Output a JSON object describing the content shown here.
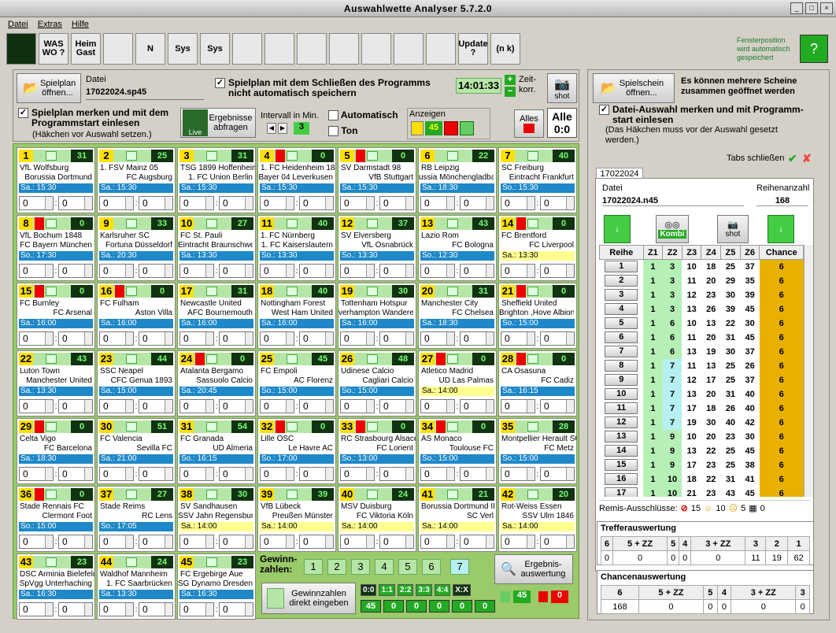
{
  "window": {
    "title": "Auswahlwette Analyser 5.7.2.0"
  },
  "menu": [
    "Datei",
    "Extras",
    "Hilfe"
  ],
  "toolbar": [
    "",
    "WAS WO ?",
    "Heim Gast",
    "",
    "N",
    "Sys",
    "Sys",
    "",
    "",
    "",
    "",
    "",
    "",
    "",
    "Update ?",
    "(n k)"
  ],
  "fenster_note": "Fensterposition wird automatisch gespeichert",
  "spielplan": {
    "open_label": "Spielplan öffnen...",
    "file_label": "Datei",
    "file_value": "17022024.sp45",
    "nosave_label": "Spielplan mit dem Schließen des Programms nicht automatisch speichern",
    "time": "14:01:33",
    "zeit_label": "Zeit-korr.",
    "shot": "shot",
    "remember_label": "Spielplan merken und mit dem Programmstart einlesen",
    "remember_hint": "(Häkchen vor Auswahl setzen.)",
    "results_btn": "Ergebnisse abfragen",
    "live": "Live",
    "interval_label": "Intervall in Min.",
    "interval_value": "3",
    "auto_label": "Automatisch",
    "ton_label": "Ton",
    "anzeigen_label": "Anzeigen",
    "anzeigen_count": "45",
    "alles_label": "Alles",
    "alles_score": "Alle 0:0"
  },
  "matches": [
    {
      "n": "1",
      "home": "VfL Wolfsburg",
      "away": "Borussia Dortmund",
      "date": "Sa.: 15:30",
      "cnt": "31",
      "red": false,
      "dy": false
    },
    {
      "n": "2",
      "home": "1. FSV Mainz 05",
      "away": "FC Augsburg",
      "date": "Sa.: 15:30",
      "cnt": "25",
      "red": false,
      "dy": false
    },
    {
      "n": "3",
      "home": "TSG 1899 Hoffenheim",
      "away": "1. FC Union Berlin",
      "date": "Sa.: 15:30",
      "cnt": "31",
      "red": false,
      "dy": false
    },
    {
      "n": "4",
      "home": "1. FC Heidenheim 1846",
      "away": "Bayer 04 Leverkusen",
      "date": "Sa.: 15:30",
      "cnt": "0",
      "red": true,
      "dy": false
    },
    {
      "n": "5",
      "home": "SV Darmstadt 98",
      "away": "VfB Stuttgart",
      "date": "Sa.: 15:30",
      "cnt": "0",
      "red": true,
      "dy": false
    },
    {
      "n": "6",
      "home": "RB Leipzig",
      "away": "ussia Mönchengladbach",
      "date": "Sa.: 18:30",
      "cnt": "22",
      "red": false,
      "dy": false
    },
    {
      "n": "7",
      "home": "SC Freiburg",
      "away": "Eintracht Frankfurt",
      "date": "So.: 15:30",
      "cnt": "40",
      "red": false,
      "dy": false
    },
    {
      "n": "8",
      "home": "VfL Bochum 1848",
      "away": "FC Bayern München",
      "date": "So.: 17:30",
      "cnt": "0",
      "red": true,
      "dy": false
    },
    {
      "n": "9",
      "home": "Karlsruher SC",
      "away": "Fortuna Düsseldorf",
      "date": "Sa.: 20:30",
      "cnt": "33",
      "red": false,
      "dy": false
    },
    {
      "n": "10",
      "home": "FC St. Pauli",
      "away": "Eintracht Braunschweig",
      "date": "Sa.: 13:30",
      "cnt": "27",
      "red": false,
      "dy": false
    },
    {
      "n": "11",
      "home": "1. FC Nürnberg",
      "away": "1. FC Kaiserslautern",
      "date": "So.: 13:30",
      "cnt": "40",
      "red": false,
      "dy": false
    },
    {
      "n": "12",
      "home": "SV Elversberg",
      "away": "VfL Osnabrück",
      "date": "So.: 13:30",
      "cnt": "37",
      "red": false,
      "dy": false
    },
    {
      "n": "13",
      "home": "Lazio Rom",
      "away": "FC Bologna",
      "date": "So.: 12:30",
      "cnt": "43",
      "red": false,
      "dy": false
    },
    {
      "n": "14",
      "home": "FC Brentford",
      "away": "FC Liverpool",
      "date": "Sa.: 13:30",
      "cnt": "0",
      "red": true,
      "dy": true
    },
    {
      "n": "15",
      "home": "FC Burnley",
      "away": "FC Arsenal",
      "date": "Sa.: 16:00",
      "cnt": "0",
      "red": true,
      "dy": false
    },
    {
      "n": "16",
      "home": "FC Fulham",
      "away": "Aston Villa",
      "date": "Sa.: 16:00",
      "cnt": "0",
      "red": true,
      "dy": false
    },
    {
      "n": "17",
      "home": "Newcastle United",
      "away": "AFC Bournemouth",
      "date": "Sa.: 16:00",
      "cnt": "31",
      "red": false,
      "dy": false
    },
    {
      "n": "18",
      "home": "Nottingham Forest",
      "away": "West Ham United",
      "date": "Sa.: 16:00",
      "cnt": "40",
      "red": false,
      "dy": false
    },
    {
      "n": "19",
      "home": "Tottenham Hotspur",
      "away": "verhampton Wanderers",
      "date": "Sa.: 16:00",
      "cnt": "30",
      "red": false,
      "dy": false
    },
    {
      "n": "20",
      "home": "Manchester City",
      "away": "FC Chelsea",
      "date": "Sa.: 18:30",
      "cnt": "31",
      "red": false,
      "dy": false
    },
    {
      "n": "21",
      "home": "Sheffield United",
      "away": "Brighton ,Hove Albion",
      "date": "So.: 15:00",
      "cnt": "0",
      "red": true,
      "dy": false
    },
    {
      "n": "22",
      "home": "Luton Town",
      "away": "Manchester United",
      "date": "Sa.: 13:30",
      "cnt": "43",
      "red": false,
      "dy": false
    },
    {
      "n": "23",
      "home": "SSC Neapel",
      "away": "CFC Genua 1893",
      "date": "Sa.: 15:00",
      "cnt": "44",
      "red": false,
      "dy": false
    },
    {
      "n": "24",
      "home": "Atalanta Bergamo",
      "away": "Sassuolo Calcio",
      "date": "Sa.: 20:45",
      "cnt": "0",
      "red": true,
      "dy": false
    },
    {
      "n": "25",
      "home": "FC Empoli",
      "away": "AC Florenz",
      "date": "So.: 15:00",
      "cnt": "45",
      "red": false,
      "dy": false
    },
    {
      "n": "26",
      "home": "Udinese Calcio",
      "away": "Cagliari Calcio",
      "date": "So.: 15:00",
      "cnt": "48",
      "red": false,
      "dy": false
    },
    {
      "n": "27",
      "home": "Atletico Madrid",
      "away": "UD Las Palmas",
      "date": "Sa.: 14:00",
      "cnt": "0",
      "red": true,
      "dy": true
    },
    {
      "n": "28",
      "home": "CA Osasuna",
      "away": "FC Cadiz",
      "date": "Sa.: 16:15",
      "cnt": "0",
      "red": true,
      "dy": false
    },
    {
      "n": "29",
      "home": "Celta Vigo",
      "away": "FC Barcelona",
      "date": "Sa.: 18:30",
      "cnt": "0",
      "red": true,
      "dy": false
    },
    {
      "n": "30",
      "home": "FC Valencia",
      "away": "Sevilla FC",
      "date": "Sa.: 21:00",
      "cnt": "51",
      "red": false,
      "dy": false
    },
    {
      "n": "31",
      "home": "FC Granada",
      "away": "UD Almeria",
      "date": "So.: 16:15",
      "cnt": "54",
      "red": false,
      "dy": false
    },
    {
      "n": "32",
      "home": "Lille OSC",
      "away": "Le Havre AC",
      "date": "So.: 17:00",
      "cnt": "0",
      "red": true,
      "dy": false
    },
    {
      "n": "33",
      "home": "RC Strasbourg Alsace",
      "away": "FC Lorient",
      "date": "So.: 13:00",
      "cnt": "0",
      "red": true,
      "dy": false
    },
    {
      "n": "34",
      "home": "AS Monaco",
      "away": "Toulouse FC",
      "date": "So.: 15:00",
      "cnt": "0",
      "red": true,
      "dy": false
    },
    {
      "n": "35",
      "home": "Montpellier Herault SC",
      "away": "FC Metz",
      "date": "So.: 15:00",
      "cnt": "28",
      "red": false,
      "dy": false
    },
    {
      "n": "36",
      "home": "Stade Rennais FC",
      "away": "Clermont Foot",
      "date": "So.: 15:00",
      "cnt": "0",
      "red": true,
      "dy": false
    },
    {
      "n": "37",
      "home": "Stade Reims",
      "away": "RC Lens",
      "date": "So.: 17:05",
      "cnt": "27",
      "red": false,
      "dy": false
    },
    {
      "n": "38",
      "home": "SV Sandhausen",
      "away": "SSV Jahn Regensburg",
      "date": "Sa.: 14:00",
      "cnt": "30",
      "red": false,
      "dy": true
    },
    {
      "n": "39",
      "home": "VfB Lübeck",
      "away": "Preußen Münster",
      "date": "Sa.: 14:00",
      "cnt": "39",
      "red": false,
      "dy": true
    },
    {
      "n": "40",
      "home": "MSV Duisburg",
      "away": "FC Viktoria Köln",
      "date": "Sa.: 14:00",
      "cnt": "24",
      "red": false,
      "dy": true
    },
    {
      "n": "41",
      "home": "Borussia Dortmund II",
      "away": "SC Verl",
      "date": "Sa.: 14:00",
      "cnt": "21",
      "red": false,
      "dy": true
    },
    {
      "n": "42",
      "home": "Rot-Weiss Essen",
      "away": "SSV Ulm 1846",
      "date": "Sa.: 14:00",
      "cnt": "20",
      "red": false,
      "dy": true
    },
    {
      "n": "43",
      "home": "DSC Arminia Bielefeld",
      "away": "SpVgg Unterhaching",
      "date": "Sa.: 16:30",
      "cnt": "23",
      "red": false,
      "dy": false
    },
    {
      "n": "44",
      "home": "Waldhof Mannheim",
      "away": "1. FC Saarbrücken",
      "date": "Sa.: 13:30",
      "cnt": "24",
      "red": false,
      "dy": false
    },
    {
      "n": "45",
      "home": "FC Ergebirge Aue",
      "away": "SG Dynamo Dresden",
      "date": "Sa.: 16:30",
      "cnt": "23",
      "red": false,
      "dy": false
    }
  ],
  "score": "0",
  "gewinn": {
    "label": "Gewinn-zahlen:",
    "numbers": [
      "1",
      "2",
      "3",
      "4",
      "5",
      "6",
      "7"
    ],
    "direct_label": "Gewinnzahlen direkt eingeben",
    "eval_label": "Ergebnis-auswertung",
    "score_labels": [
      "0:0",
      "1:1",
      "2:2",
      "3:3",
      "4:4",
      "X:X"
    ],
    "score_counts": [
      "45",
      "0",
      "0",
      "0",
      "0",
      "0"
    ],
    "lock_green": "45",
    "lock_red": "0"
  },
  "right": {
    "open_label": "Spielschein öffnen...",
    "together_label": "Es können mehrere Scheine zusammen geöffnet werden",
    "remember_label": "Datei-Auswahl merken und mit Programm-start einlesen",
    "remember_hint": "(Das Häkchen muss vor der Auswahl gesetzt werden.)",
    "tabs_close": "Tabs schließen",
    "tab": "17022024",
    "file_label": "Datei",
    "file_value": "17022024.n45",
    "rows_label": "Reihenanzahl",
    "rows_value": "168",
    "kombi": "Kombi",
    "shot": "shot"
  },
  "chance_table": {
    "headers": [
      "Reihe",
      "Z1",
      "Z2",
      "Z3",
      "Z4",
      "Z5",
      "Z6",
      "Chance"
    ],
    "rows": [
      [
        "1",
        "1",
        "3",
        "10",
        "18",
        "25",
        "37",
        "6"
      ],
      [
        "2",
        "1",
        "3",
        "11",
        "20",
        "29",
        "35",
        "6"
      ],
      [
        "3",
        "1",
        "3",
        "12",
        "23",
        "30",
        "39",
        "6"
      ],
      [
        "4",
        "1",
        "3",
        "13",
        "26",
        "39",
        "45",
        "6"
      ],
      [
        "5",
        "1",
        "6",
        "10",
        "13",
        "22",
        "30",
        "6"
      ],
      [
        "6",
        "1",
        "6",
        "11",
        "20",
        "31",
        "45",
        "6"
      ],
      [
        "7",
        "1",
        "6",
        "13",
        "19",
        "30",
        "37",
        "6"
      ],
      [
        "8",
        "1",
        "7",
        "11",
        "13",
        "25",
        "26",
        "6"
      ],
      [
        "9",
        "1",
        "7",
        "12",
        "17",
        "25",
        "37",
        "6"
      ],
      [
        "10",
        "1",
        "7",
        "13",
        "20",
        "31",
        "40",
        "6"
      ],
      [
        "11",
        "1",
        "7",
        "17",
        "18",
        "26",
        "40",
        "6"
      ],
      [
        "12",
        "1",
        "7",
        "19",
        "30",
        "40",
        "42",
        "6"
      ],
      [
        "13",
        "1",
        "9",
        "10",
        "20",
        "23",
        "30",
        "6"
      ],
      [
        "14",
        "1",
        "9",
        "13",
        "22",
        "25",
        "45",
        "6"
      ],
      [
        "15",
        "1",
        "9",
        "17",
        "23",
        "25",
        "38",
        "6"
      ],
      [
        "16",
        "1",
        "10",
        "18",
        "22",
        "31",
        "41",
        "6"
      ],
      [
        "17",
        "1",
        "10",
        "21",
        "23",
        "43",
        "45",
        "6"
      ]
    ]
  },
  "remis": {
    "label": "Remis-Ausschlüsse:",
    "a": "15",
    "b": "10",
    "c": "5",
    "d": "0"
  },
  "treffer": {
    "title": "Trefferauswertung",
    "headers": [
      "6",
      "5 + ZZ",
      "5",
      "4",
      "3 + ZZ",
      "3",
      "2",
      "1"
    ],
    "values": [
      "0",
      "0",
      "0",
      "0",
      "0",
      "11",
      "19",
      "62"
    ]
  },
  "chancen": {
    "title": "Chancenauswertung",
    "headers": [
      "6",
      "5 + ZZ",
      "5",
      "4",
      "3 + ZZ",
      "3"
    ],
    "values": [
      "168",
      "0",
      "0",
      "0",
      "0",
      "0"
    ]
  }
}
